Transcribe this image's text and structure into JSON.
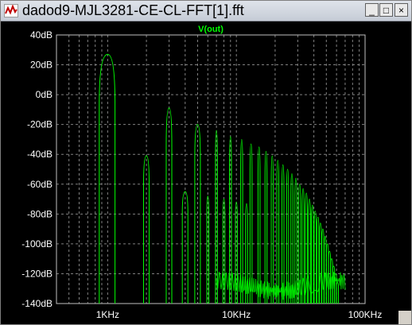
{
  "window": {
    "title": "dadod9-MJL3281-CE-CL-FFT[1].fft",
    "controls": {
      "minimize": "_",
      "maximize": "□",
      "close": "×"
    }
  },
  "icons": {
    "app": "waveform-icon"
  },
  "colors": {
    "background": "#000000",
    "trace": "#00ff00",
    "grid": "#808080",
    "axis_text": "#ffffff",
    "trace_title": "#00ff00"
  },
  "chart_data": {
    "type": "line",
    "title": "V(out)",
    "xlabel": "",
    "ylabel": "",
    "x_scale": "log",
    "xlim": [
      400,
      100000
    ],
    "ylim": [
      -140,
      40
    ],
    "grid": true,
    "yticks": [
      {
        "value": 40,
        "label": "40dB"
      },
      {
        "value": 20,
        "label": "20dB"
      },
      {
        "value": 0,
        "label": "0dB"
      },
      {
        "value": -20,
        "label": "-20dB"
      },
      {
        "value": -40,
        "label": "-40dB"
      },
      {
        "value": -60,
        "label": "-60dB"
      },
      {
        "value": -80,
        "label": "-80dB"
      },
      {
        "value": -100,
        "label": "-100dB"
      },
      {
        "value": -120,
        "label": "-120dB"
      },
      {
        "value": -140,
        "label": "-140dB"
      }
    ],
    "xticks": [
      {
        "value": 1000,
        "label": "1KHz"
      },
      {
        "value": 10000,
        "label": "10KHz"
      },
      {
        "value": 100000,
        "label": "100KHz"
      }
    ],
    "peaks": [
      {
        "freq": 1000,
        "db": 27
      },
      {
        "freq": 2000,
        "db": -41
      },
      {
        "freq": 3000,
        "db": -9
      },
      {
        "freq": 4000,
        "db": -65
      },
      {
        "freq": 5000,
        "db": -20
      },
      {
        "freq": 6000,
        "db": -68
      },
      {
        "freq": 7000,
        "db": -24
      },
      {
        "freq": 8000,
        "db": -70
      },
      {
        "freq": 9000,
        "db": -28
      },
      {
        "freq": 10000,
        "db": -72
      },
      {
        "freq": 11000,
        "db": -30
      },
      {
        "freq": 12000,
        "db": -73
      },
      {
        "freq": 13000,
        "db": -33
      },
      {
        "freq": 15000,
        "db": -35
      },
      {
        "freq": 17000,
        "db": -38
      },
      {
        "freq": 19000,
        "db": -41
      },
      {
        "freq": 21000,
        "db": -44
      },
      {
        "freq": 23000,
        "db": -47
      },
      {
        "freq": 25000,
        "db": -50
      },
      {
        "freq": 27000,
        "db": -53
      },
      {
        "freq": 29000,
        "db": -56
      },
      {
        "freq": 31000,
        "db": -60
      },
      {
        "freq": 33000,
        "db": -63
      },
      {
        "freq": 35000,
        "db": -66
      },
      {
        "freq": 37000,
        "db": -70
      },
      {
        "freq": 39000,
        "db": -74
      },
      {
        "freq": 41000,
        "db": -78
      },
      {
        "freq": 43000,
        "db": -82
      },
      {
        "freq": 45000,
        "db": -86
      },
      {
        "freq": 47000,
        "db": -90
      },
      {
        "freq": 49000,
        "db": -95
      },
      {
        "freq": 51000,
        "db": -100
      },
      {
        "freq": 53000,
        "db": -105
      },
      {
        "freq": 55000,
        "db": -110
      },
      {
        "freq": 57000,
        "db": -115
      },
      {
        "freq": 59000,
        "db": -120
      },
      {
        "freq": 61000,
        "db": -126
      }
    ]
  }
}
